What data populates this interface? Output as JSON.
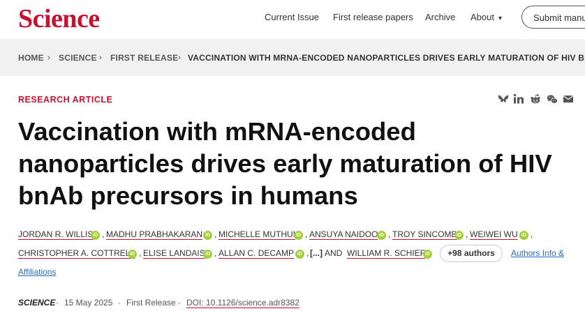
{
  "header": {
    "logo": "Science",
    "nav": [
      "Current Issue",
      "First release papers",
      "Archive",
      "About"
    ],
    "submit_label": "Submit manuscript"
  },
  "breadcrumb": [
    "HOME",
    "SCIENCE",
    "FIRST RELEASE",
    "VACCINATION WITH MRNA-ENCODED NANOPARTICLES DRIVES EARLY MATURATION OF HIV BNA..."
  ],
  "article": {
    "kicker": "RESEARCH ARTICLE",
    "title": "Vaccination with mRNA-encoded nanoparticles drives early maturation of HIV bnAb precursors in humans",
    "authors": [
      "JORDAN R. WILLIS",
      "MADHU PRABHAKARAN",
      "MICHELLE MUTHUI",
      "ANSUYA NAIDOO",
      "TROY SINCOMB",
      "WEIWEI WU",
      "CHRISTOPHER A. COTTRELL",
      "ELISE LANDAIS",
      "ALLAN C. DECAMP"
    ],
    "ellipsis": "[...]",
    "and_text": ", AND",
    "last_author": "WILLIAM R. SCHIEF",
    "more_authors": "+98 authors",
    "info_link_1": "Authors Info &",
    "info_link_2": "Affiliations",
    "orcid_glyph": "iD"
  },
  "meta": {
    "journal": "SCIENCE",
    "date": "15 May 2025",
    "status": "First Release",
    "doi": "DOI: 10.1126/science.adr8382"
  },
  "share_icons": [
    "bluesky-icon",
    "linkedin-icon",
    "reddit-icon",
    "wechat-icon",
    "email-icon"
  ],
  "colors": {
    "brand": "#c41230",
    "orcid": "#a6ce39",
    "link": "#2a6ebb"
  }
}
